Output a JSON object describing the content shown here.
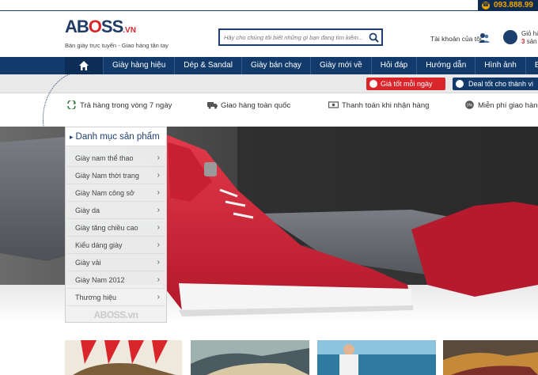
{
  "topbar": {
    "hotline": "093.888.99"
  },
  "header": {
    "logo": {
      "part1": "AB",
      "part2": "O",
      "part3": "SS",
      "suffix": ".VN",
      "tagline": "Bán giày trực tuyến - Giao hàng tận tay"
    },
    "search_placeholder": "Hãy cho chúng tôi biết những gì bạn đang tìm kiếm...",
    "account_label": "Tài khoản của tôi",
    "cart_line1": "Giỏ hà",
    "cart_count": "3",
    "cart_line2": "sản"
  },
  "nav": {
    "items": [
      "Giày hàng hiệu",
      "Dép & Sandal",
      "Giày bán chạy",
      "Giày mới về",
      "Hỏi đáp",
      "Hướng dẫn",
      "Hình ảnh",
      "Blo"
    ]
  },
  "promos": {
    "best_price": "Giá tốt mỗi ngày",
    "deal": "Deal tốt cho thành vi"
  },
  "benefits": [
    {
      "icon": "return-icon",
      "label": "Trả hàng trong vòng 7 ngày"
    },
    {
      "icon": "truck-icon",
      "label": "Giao hàng toàn quốc"
    },
    {
      "icon": "cash-icon",
      "label": "Thanh toán khi nhận hàng"
    },
    {
      "icon": "badge-icon",
      "label": "Miễn phí giao hàng"
    }
  ],
  "category": {
    "title": "Danh mục sản phẩm",
    "items": [
      "Giày nam thể thao",
      "Giày Nam thời trang",
      "Giày Nam công sở",
      "Giày da",
      "Giày tăng chiều cao",
      "Kiểu dáng giày",
      "Giày vải",
      "Giày Nam 2012",
      "Thương hiệu"
    ],
    "watermark": "ABOSS.vn"
  },
  "colors": {
    "brand_navy": "#123a6b",
    "brand_red": "#d9262b",
    "hotline_gold": "#f0a500"
  }
}
